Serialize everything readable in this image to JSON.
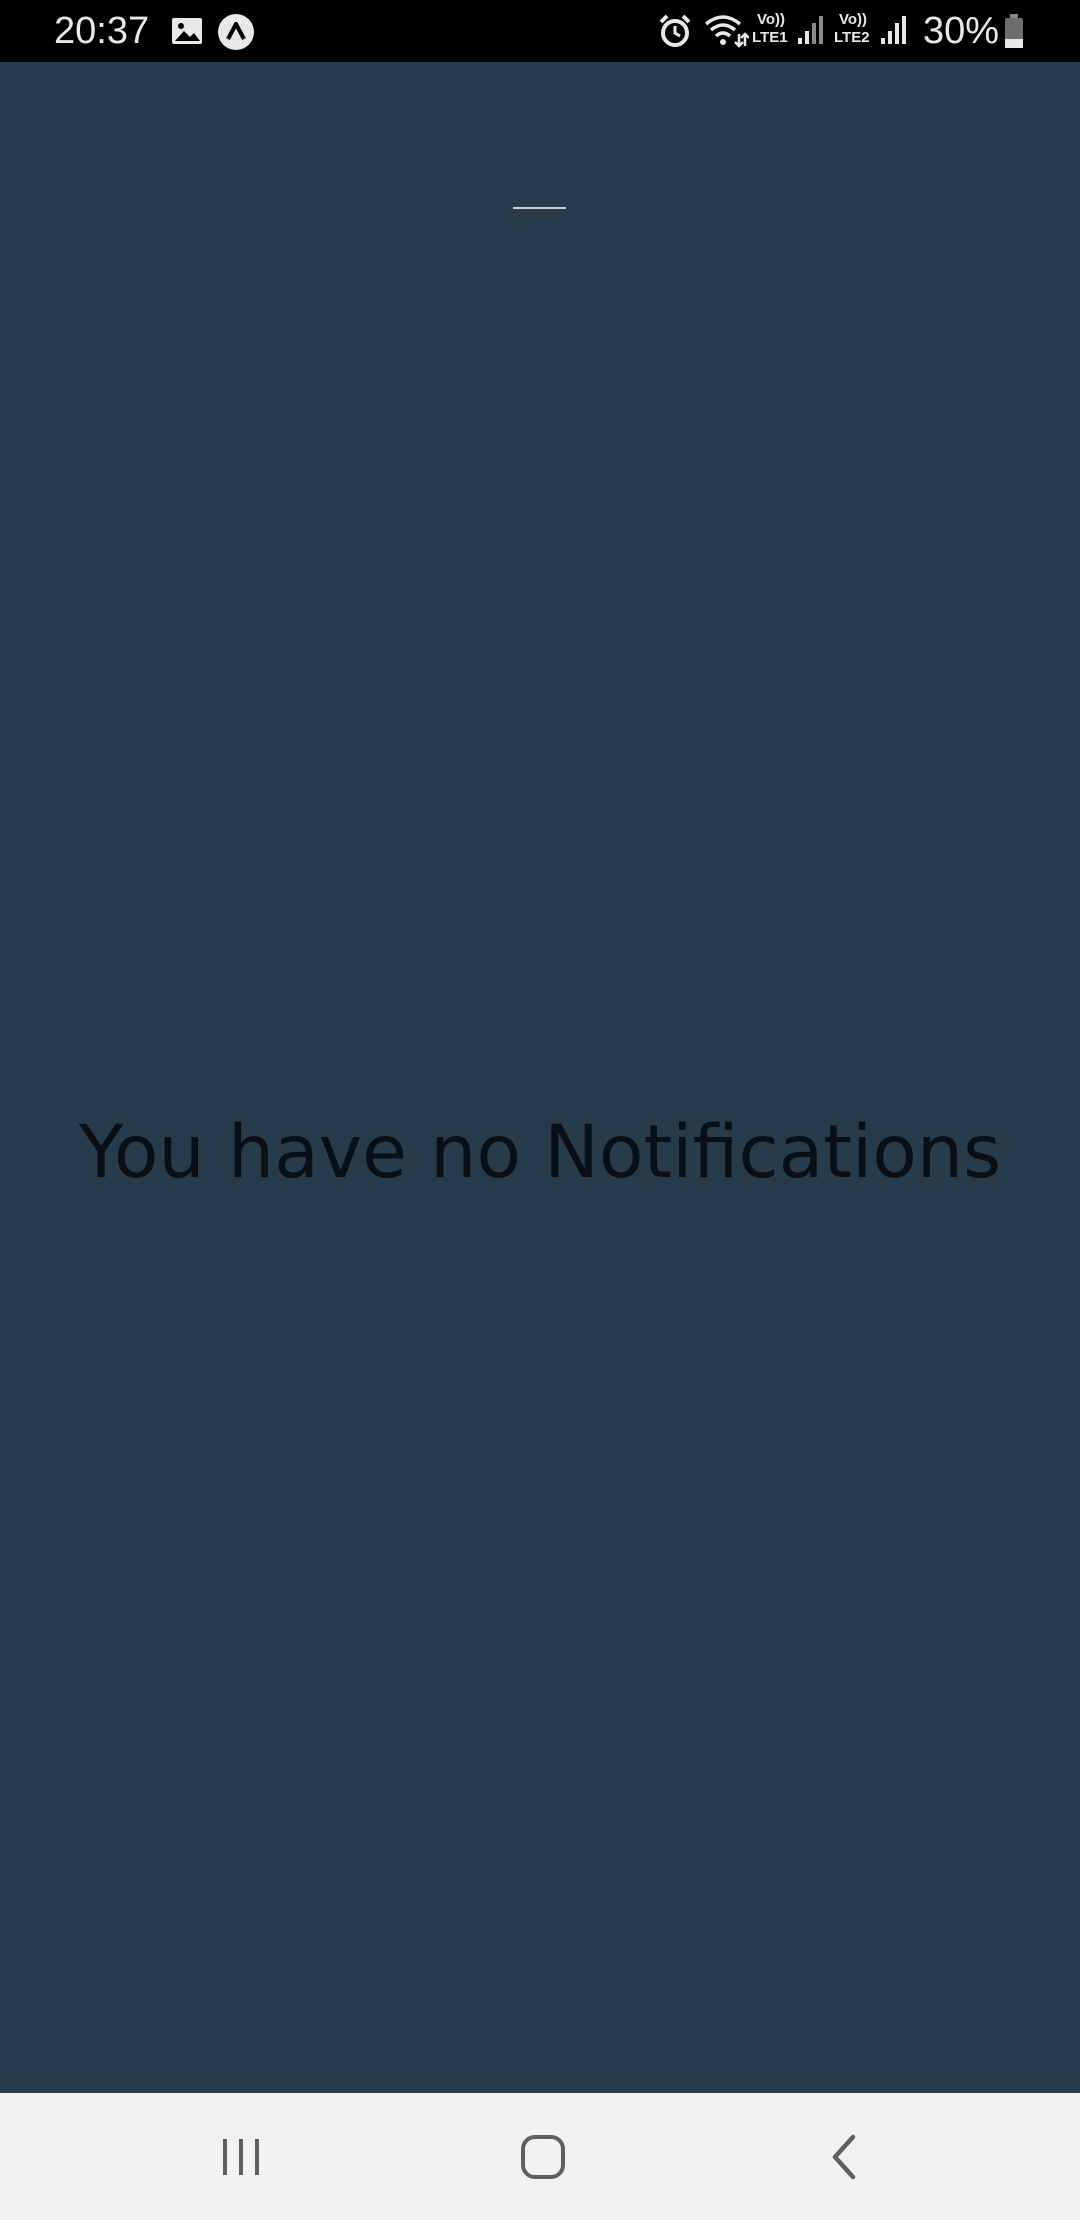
{
  "status_bar": {
    "time": "20:37",
    "battery_percent": "30%",
    "sim1_label_top": "Vo))",
    "sim1_label_bottom": "LTE1",
    "sim2_label_top": "Vo))",
    "sim2_label_bottom": "LTE2",
    "battery_level": 0.3,
    "icons": [
      "image-icon",
      "app-notification-icon",
      "alarm-icon",
      "wifi-icon",
      "signal-sim1-icon",
      "signal-sim2-icon",
      "battery-icon"
    ]
  },
  "main": {
    "empty_message": "You have no Notifications",
    "background_color": "#263b4c"
  },
  "nav_bar": {
    "buttons": [
      "recent-apps",
      "home",
      "back"
    ],
    "background_color": "#f2f2f2"
  }
}
